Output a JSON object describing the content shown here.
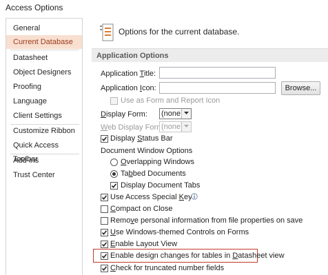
{
  "window": {
    "title": "Access Options"
  },
  "sidebar": {
    "items": [
      {
        "label": "General"
      },
      {
        "label": "Current Database"
      },
      {
        "label": "Datasheet"
      },
      {
        "label": "Object Designers"
      },
      {
        "label": "Proofing"
      },
      {
        "label": "Language"
      },
      {
        "label": "Client Settings"
      },
      {
        "label": "Customize Ribbon"
      },
      {
        "label": "Quick Access Toolbar"
      },
      {
        "label": "Add-ins"
      },
      {
        "label": "Trust Center"
      }
    ],
    "active": "Current Database"
  },
  "header": {
    "text": "Options for the current database."
  },
  "section": {
    "title": "Application Options"
  },
  "app_title": {
    "label_pre": "Application ",
    "label_u": "T",
    "label_post": "itle:",
    "value": ""
  },
  "app_icon": {
    "label_pre": "Application ",
    "label_u": "I",
    "label_post": "con:",
    "value": "",
    "browse_label": "Browse..."
  },
  "form_report_icon": {
    "label": "Use as Form and Report Icon",
    "checked": false
  },
  "display_form": {
    "label_u": "D",
    "label_post": "isplay Form:",
    "value": "(none)"
  },
  "web_display_form": {
    "label_u": "W",
    "label_post": "eb Display Form:",
    "value": "(none)"
  },
  "status_bar": {
    "label_pre": "Display ",
    "label_u": "S",
    "label_post": "tatus Bar",
    "checked": true
  },
  "doc_window": {
    "label": "Document Window Options"
  },
  "overlapping": {
    "label_u": "O",
    "label_post": "verlapping Windows",
    "selected": false
  },
  "tabbed": {
    "label_pre": "Ta",
    "label_u": "b",
    "label_post": "bed Documents",
    "selected": true
  },
  "doc_tabs": {
    "label": "Display Document Tabs",
    "checked": true
  },
  "special_keys": {
    "label_pre": "Use Access Special ",
    "label_u": "K",
    "label_post": "eys",
    "checked": true
  },
  "compact": {
    "label_u": "C",
    "label_post": "ompact on Close",
    "checked": false
  },
  "remove_personal": {
    "label_pre": "Remo",
    "label_u": "v",
    "label_post": "e personal information from file properties on save",
    "checked": false
  },
  "themed_controls": {
    "label_u": "U",
    "label_post": "se Windows-themed Controls on Forms",
    "checked": true
  },
  "layout_view": {
    "label_u": "E",
    "label_post": "nable Layout View",
    "checked": true
  },
  "design_changes": {
    "label_pre": "Enable design changes for tables in ",
    "label_u": "D",
    "label_post": "atasheet view",
    "checked": true
  },
  "truncated": {
    "label_u": "C",
    "label_post": "heck for truncated number fields",
    "checked": true
  },
  "colors": {
    "active_nav_bg": "#f8dfd0",
    "highlight_border": "#c0392b"
  }
}
